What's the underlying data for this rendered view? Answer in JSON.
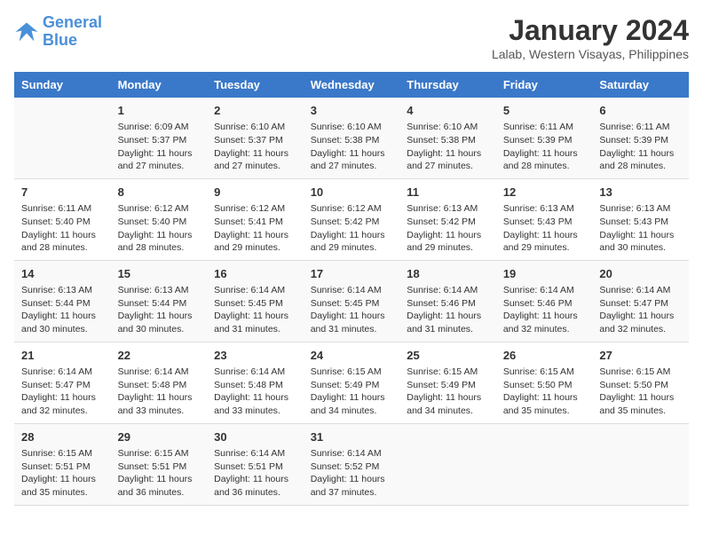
{
  "header": {
    "logo_line1": "General",
    "logo_line2": "Blue",
    "title": "January 2024",
    "subtitle": "Lalab, Western Visayas, Philippines"
  },
  "columns": [
    "Sunday",
    "Monday",
    "Tuesday",
    "Wednesday",
    "Thursday",
    "Friday",
    "Saturday"
  ],
  "weeks": [
    [
      {
        "num": "",
        "sunrise": "",
        "sunset": "",
        "daylight": ""
      },
      {
        "num": "1",
        "sunrise": "Sunrise: 6:09 AM",
        "sunset": "Sunset: 5:37 PM",
        "daylight": "Daylight: 11 hours and 27 minutes."
      },
      {
        "num": "2",
        "sunrise": "Sunrise: 6:10 AM",
        "sunset": "Sunset: 5:37 PM",
        "daylight": "Daylight: 11 hours and 27 minutes."
      },
      {
        "num": "3",
        "sunrise": "Sunrise: 6:10 AM",
        "sunset": "Sunset: 5:38 PM",
        "daylight": "Daylight: 11 hours and 27 minutes."
      },
      {
        "num": "4",
        "sunrise": "Sunrise: 6:10 AM",
        "sunset": "Sunset: 5:38 PM",
        "daylight": "Daylight: 11 hours and 27 minutes."
      },
      {
        "num": "5",
        "sunrise": "Sunrise: 6:11 AM",
        "sunset": "Sunset: 5:39 PM",
        "daylight": "Daylight: 11 hours and 28 minutes."
      },
      {
        "num": "6",
        "sunrise": "Sunrise: 6:11 AM",
        "sunset": "Sunset: 5:39 PM",
        "daylight": "Daylight: 11 hours and 28 minutes."
      }
    ],
    [
      {
        "num": "7",
        "sunrise": "Sunrise: 6:11 AM",
        "sunset": "Sunset: 5:40 PM",
        "daylight": "Daylight: 11 hours and 28 minutes."
      },
      {
        "num": "8",
        "sunrise": "Sunrise: 6:12 AM",
        "sunset": "Sunset: 5:40 PM",
        "daylight": "Daylight: 11 hours and 28 minutes."
      },
      {
        "num": "9",
        "sunrise": "Sunrise: 6:12 AM",
        "sunset": "Sunset: 5:41 PM",
        "daylight": "Daylight: 11 hours and 29 minutes."
      },
      {
        "num": "10",
        "sunrise": "Sunrise: 6:12 AM",
        "sunset": "Sunset: 5:42 PM",
        "daylight": "Daylight: 11 hours and 29 minutes."
      },
      {
        "num": "11",
        "sunrise": "Sunrise: 6:13 AM",
        "sunset": "Sunset: 5:42 PM",
        "daylight": "Daylight: 11 hours and 29 minutes."
      },
      {
        "num": "12",
        "sunrise": "Sunrise: 6:13 AM",
        "sunset": "Sunset: 5:43 PM",
        "daylight": "Daylight: 11 hours and 29 minutes."
      },
      {
        "num": "13",
        "sunrise": "Sunrise: 6:13 AM",
        "sunset": "Sunset: 5:43 PM",
        "daylight": "Daylight: 11 hours and 30 minutes."
      }
    ],
    [
      {
        "num": "14",
        "sunrise": "Sunrise: 6:13 AM",
        "sunset": "Sunset: 5:44 PM",
        "daylight": "Daylight: 11 hours and 30 minutes."
      },
      {
        "num": "15",
        "sunrise": "Sunrise: 6:13 AM",
        "sunset": "Sunset: 5:44 PM",
        "daylight": "Daylight: 11 hours and 30 minutes."
      },
      {
        "num": "16",
        "sunrise": "Sunrise: 6:14 AM",
        "sunset": "Sunset: 5:45 PM",
        "daylight": "Daylight: 11 hours and 31 minutes."
      },
      {
        "num": "17",
        "sunrise": "Sunrise: 6:14 AM",
        "sunset": "Sunset: 5:45 PM",
        "daylight": "Daylight: 11 hours and 31 minutes."
      },
      {
        "num": "18",
        "sunrise": "Sunrise: 6:14 AM",
        "sunset": "Sunset: 5:46 PM",
        "daylight": "Daylight: 11 hours and 31 minutes."
      },
      {
        "num": "19",
        "sunrise": "Sunrise: 6:14 AM",
        "sunset": "Sunset: 5:46 PM",
        "daylight": "Daylight: 11 hours and 32 minutes."
      },
      {
        "num": "20",
        "sunrise": "Sunrise: 6:14 AM",
        "sunset": "Sunset: 5:47 PM",
        "daylight": "Daylight: 11 hours and 32 minutes."
      }
    ],
    [
      {
        "num": "21",
        "sunrise": "Sunrise: 6:14 AM",
        "sunset": "Sunset: 5:47 PM",
        "daylight": "Daylight: 11 hours and 32 minutes."
      },
      {
        "num": "22",
        "sunrise": "Sunrise: 6:14 AM",
        "sunset": "Sunset: 5:48 PM",
        "daylight": "Daylight: 11 hours and 33 minutes."
      },
      {
        "num": "23",
        "sunrise": "Sunrise: 6:14 AM",
        "sunset": "Sunset: 5:48 PM",
        "daylight": "Daylight: 11 hours and 33 minutes."
      },
      {
        "num": "24",
        "sunrise": "Sunrise: 6:15 AM",
        "sunset": "Sunset: 5:49 PM",
        "daylight": "Daylight: 11 hours and 34 minutes."
      },
      {
        "num": "25",
        "sunrise": "Sunrise: 6:15 AM",
        "sunset": "Sunset: 5:49 PM",
        "daylight": "Daylight: 11 hours and 34 minutes."
      },
      {
        "num": "26",
        "sunrise": "Sunrise: 6:15 AM",
        "sunset": "Sunset: 5:50 PM",
        "daylight": "Daylight: 11 hours and 35 minutes."
      },
      {
        "num": "27",
        "sunrise": "Sunrise: 6:15 AM",
        "sunset": "Sunset: 5:50 PM",
        "daylight": "Daylight: 11 hours and 35 minutes."
      }
    ],
    [
      {
        "num": "28",
        "sunrise": "Sunrise: 6:15 AM",
        "sunset": "Sunset: 5:51 PM",
        "daylight": "Daylight: 11 hours and 35 minutes."
      },
      {
        "num": "29",
        "sunrise": "Sunrise: 6:15 AM",
        "sunset": "Sunset: 5:51 PM",
        "daylight": "Daylight: 11 hours and 36 minutes."
      },
      {
        "num": "30",
        "sunrise": "Sunrise: 6:14 AM",
        "sunset": "Sunset: 5:51 PM",
        "daylight": "Daylight: 11 hours and 36 minutes."
      },
      {
        "num": "31",
        "sunrise": "Sunrise: 6:14 AM",
        "sunset": "Sunset: 5:52 PM",
        "daylight": "Daylight: 11 hours and 37 minutes."
      },
      {
        "num": "",
        "sunrise": "",
        "sunset": "",
        "daylight": ""
      },
      {
        "num": "",
        "sunrise": "",
        "sunset": "",
        "daylight": ""
      },
      {
        "num": "",
        "sunrise": "",
        "sunset": "",
        "daylight": ""
      }
    ]
  ]
}
